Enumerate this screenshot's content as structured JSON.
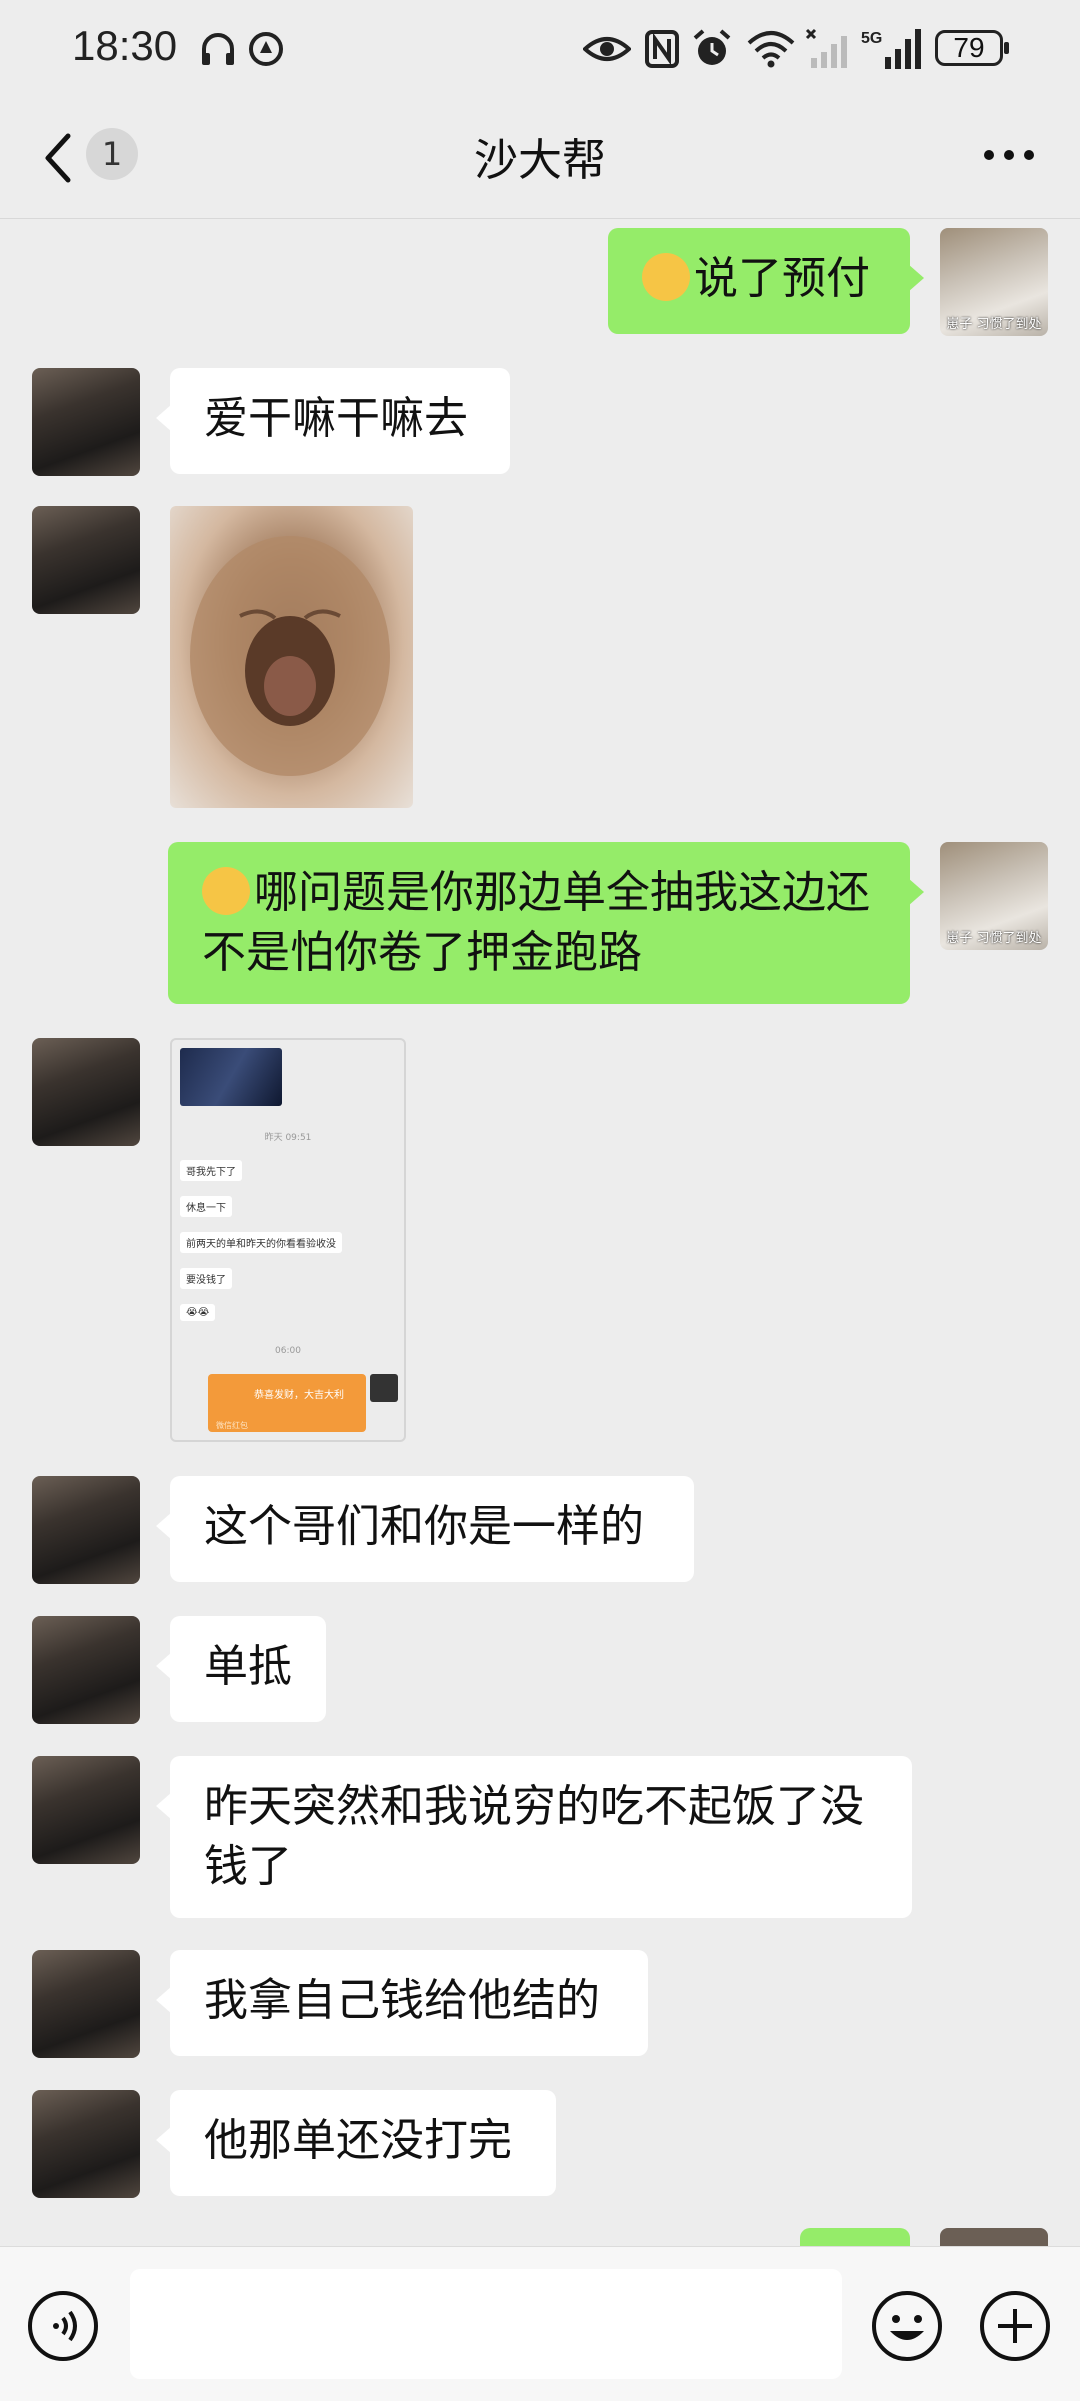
{
  "status_bar": {
    "time": "18:30",
    "icons": [
      "headphones-icon",
      "location-badge-icon",
      "eye-icon",
      "nfc-icon",
      "alarm-icon",
      "wifi-icon",
      "signal-off-icon",
      "signal-5g-icon"
    ],
    "network": "5G",
    "battery": "79"
  },
  "header": {
    "back_badge": "1",
    "title": "沙大帮"
  },
  "messages": [
    {
      "side": "out",
      "type": "text",
      "emoji": "laughing-crying",
      "text": "说了预付"
    },
    {
      "side": "in",
      "type": "text",
      "text": "爱干嘛干嘛去"
    },
    {
      "side": "in",
      "type": "image",
      "alt": "cat-yawn-sticker"
    },
    {
      "side": "out",
      "type": "text",
      "emoji": "goofy-face",
      "text": "哪问题是你那边单全抽我这边还不是怕你卷了押金跑路"
    },
    {
      "side": "in",
      "type": "image",
      "alt": "chat-screenshot"
    },
    {
      "side": "in",
      "type": "text",
      "text": "这个哥们和你是一样的"
    },
    {
      "side": "in",
      "type": "text",
      "text": "单抵"
    },
    {
      "side": "in",
      "type": "text",
      "text": "昨天突然和我说穷的吃不起饭了没钱了"
    },
    {
      "side": "in",
      "type": "text",
      "text": "我拿自己钱给他结的"
    },
    {
      "side": "in",
      "type": "text",
      "text": "他那单还没打完"
    }
  ],
  "avatars": {
    "self_caption": "崽子\n习惯了到处"
  },
  "screenshot_content": {
    "time1": "昨天 09:51",
    "msgs": [
      "哥我先下了",
      "休息一下",
      "前两天的单和昨天的你看看验收没",
      "要没钱了",
      "😭😭"
    ],
    "time2": "06:00",
    "red_packet": "恭喜发财，大吉大利",
    "red_packet_sub": "微信红包"
  },
  "colors": {
    "outgoing_bubble": "#95ec69",
    "incoming_bubble": "#ffffff",
    "background": "#ededed"
  }
}
